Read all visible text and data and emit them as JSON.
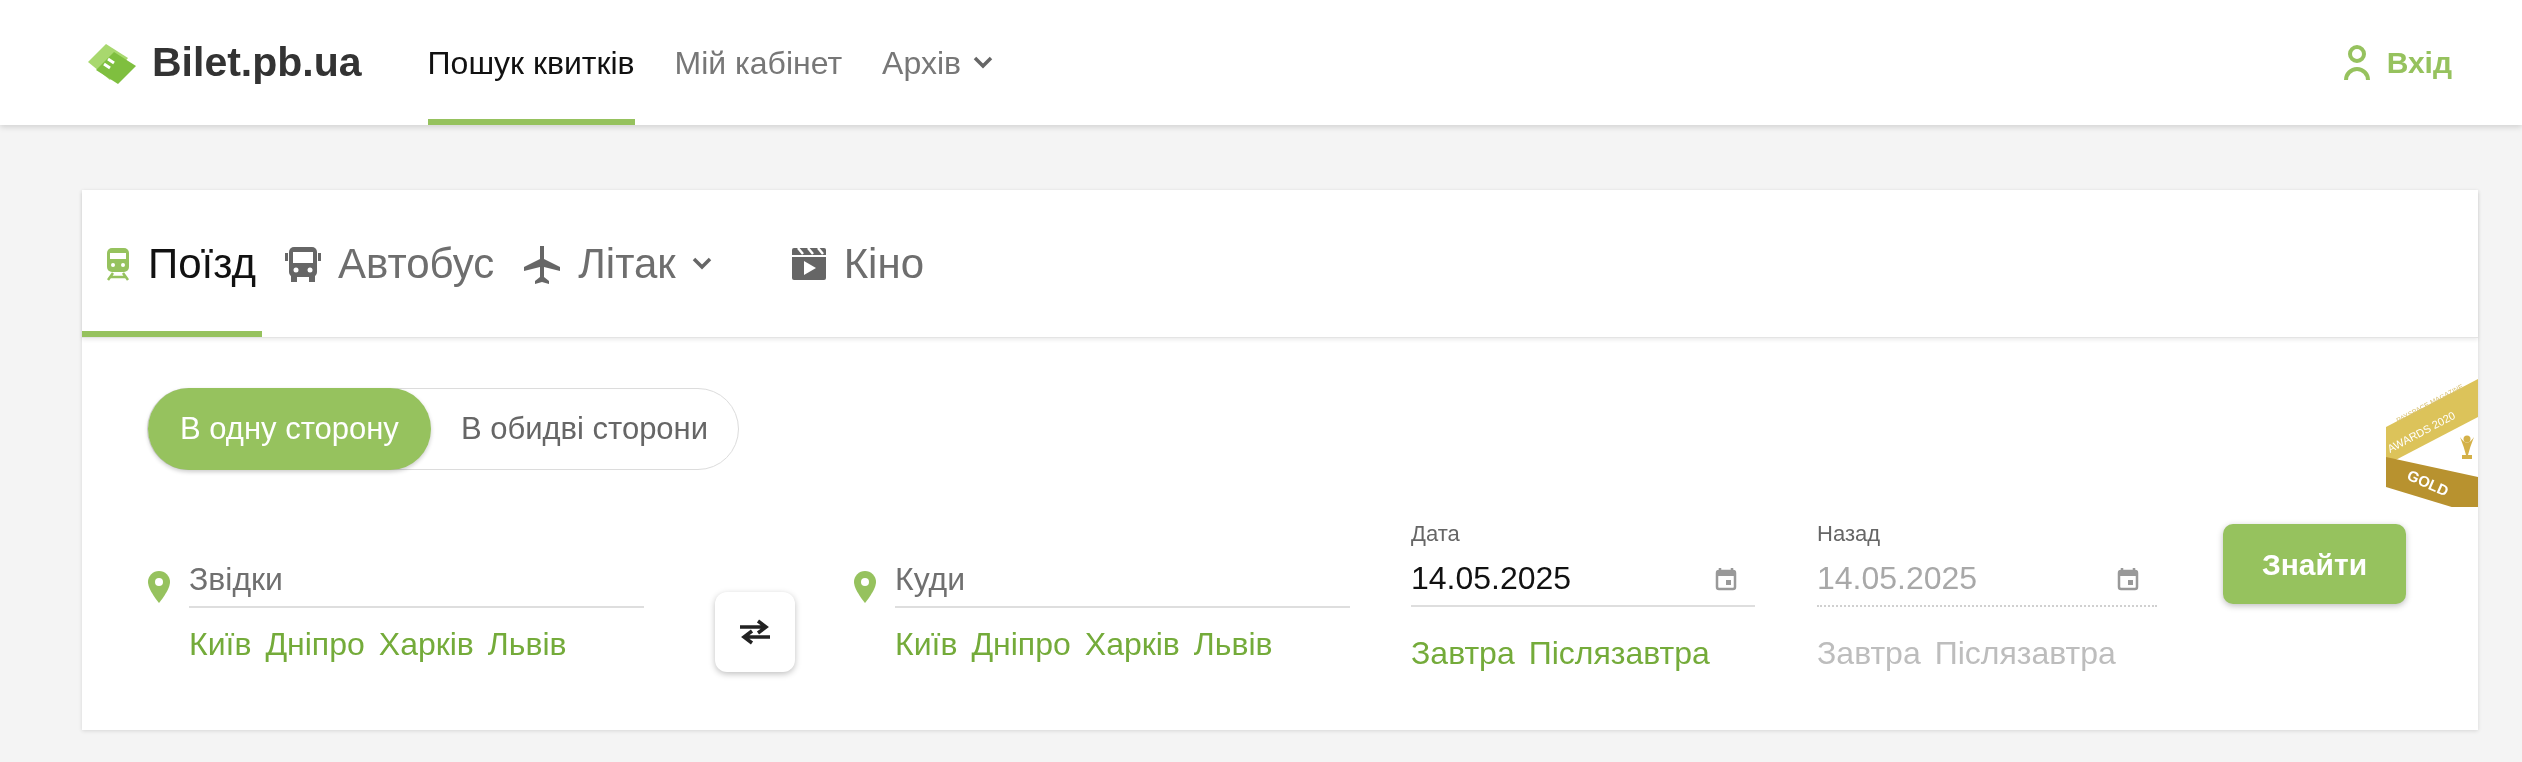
{
  "header": {
    "logo": "Bilet.pb.ua",
    "nav": [
      {
        "label": "Пошук квитків",
        "selected": true,
        "dropdown": false
      },
      {
        "label": "Мій кабінет",
        "selected": false,
        "dropdown": false
      },
      {
        "label": "Архів",
        "selected": false,
        "dropdown": true
      }
    ],
    "login": "Вхід"
  },
  "transport_tabs": [
    {
      "label": "Поїзд",
      "kind": "train",
      "selected": true,
      "dropdown": false
    },
    {
      "label": "Автобус",
      "kind": "bus",
      "selected": false,
      "dropdown": false
    },
    {
      "label": "Літак",
      "kind": "plane",
      "selected": false,
      "dropdown": true
    },
    {
      "label": "Кіно",
      "kind": "film",
      "selected": false,
      "dropdown": false
    }
  ],
  "trip_type": [
    {
      "label": "В одну сторону",
      "selected": true
    },
    {
      "label": "В обидві сторони",
      "selected": false
    }
  ],
  "route_fields": [
    {
      "placeholder": "Звідки",
      "suggestions": [
        "Київ",
        "Дніпро",
        "Харків",
        "Львів"
      ]
    },
    {
      "placeholder": "Куди",
      "suggestions": [
        "Київ",
        "Дніпро",
        "Харків",
        "Львів"
      ]
    }
  ],
  "date_fields": [
    {
      "label": "Дата",
      "value": "14.05.2025",
      "disabled": false,
      "shortcuts": [
        "Завтра",
        "Післязавтра"
      ]
    },
    {
      "label": "Назад",
      "value": "14.05.2025",
      "disabled": true,
      "shortcuts": [
        "Завтра",
        "Післязавтра"
      ]
    }
  ],
  "search_button": "Знайти",
  "award_badge": {
    "lines": [
      "PAYSPACE MAGAZINE",
      "AWARDS 2020",
      "GOLD"
    ]
  }
}
